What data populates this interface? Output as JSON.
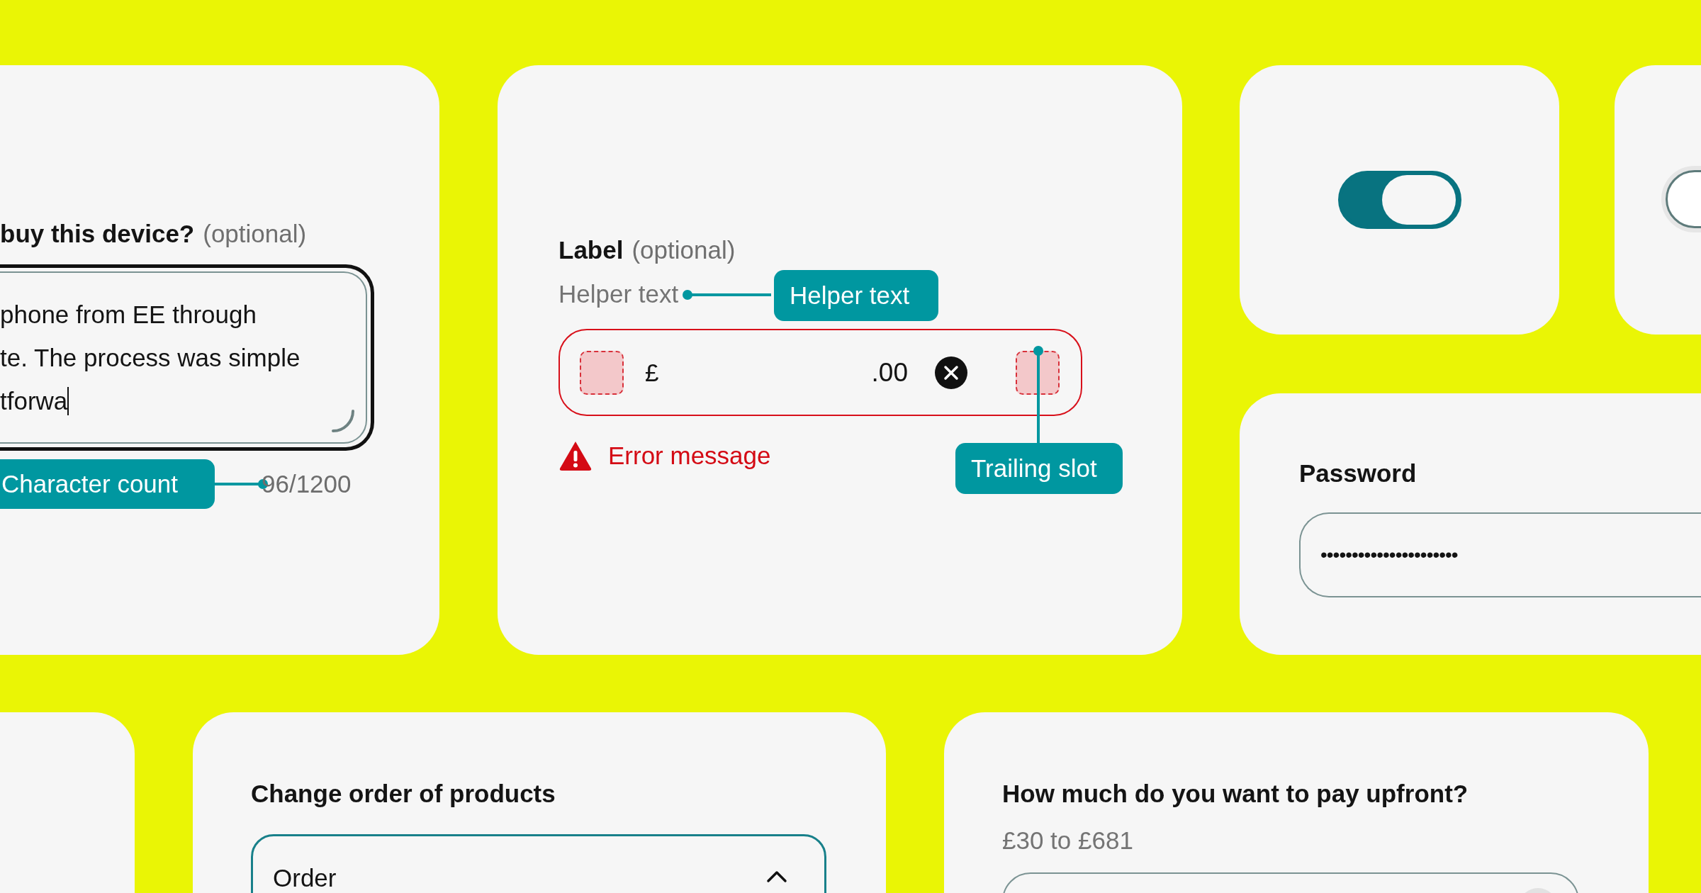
{
  "feedback": {
    "label": "buy this device?",
    "optional": "(optional)",
    "lines": [
      "phone from EE through",
      "te. The process was simple",
      "tforwa"
    ],
    "counter": "96/1200",
    "callout": "Character count"
  },
  "currency_field": {
    "label": "Label",
    "optional": "(optional)",
    "helper": "Helper text",
    "prefix": "£",
    "suffix": ".00",
    "error": true,
    "error_message": "Error message",
    "helper_callout": "Helper text",
    "trailing_callout": "Trailing slot"
  },
  "toggle": {
    "on": true
  },
  "password": {
    "label": "Password",
    "value": "••••••••••••••••••••••"
  },
  "sort_select": {
    "label": "Change order of products",
    "value": "Order",
    "expanded": true
  },
  "upfront": {
    "label": "How much do you want to pay upfront?",
    "hint": "£30 to £681"
  }
}
